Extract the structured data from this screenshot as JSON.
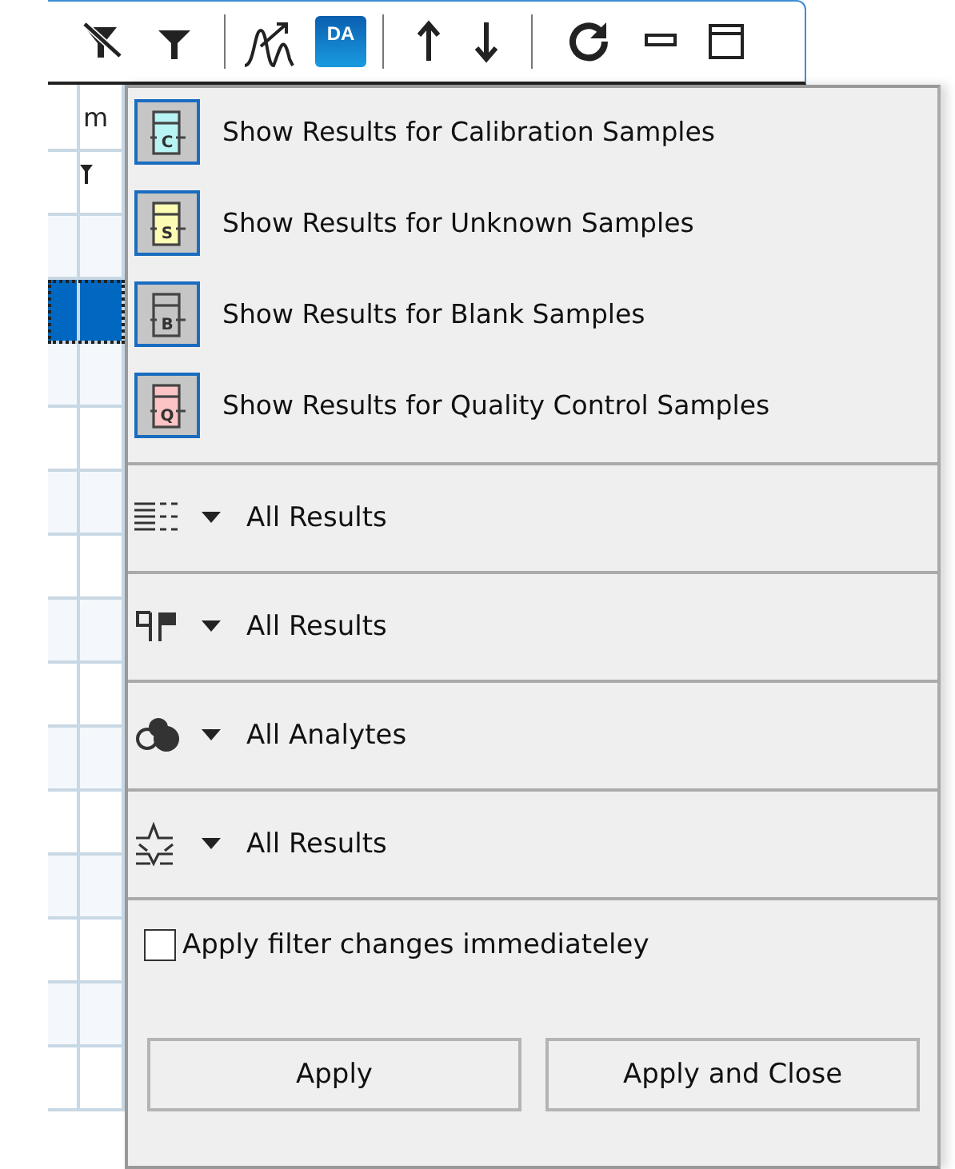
{
  "toolbar": {
    "badge": "DA"
  },
  "table": {
    "header": "m",
    "rows": [
      {
        "selected": false
      },
      {
        "selected": true
      },
      {
        "selected": false
      },
      {
        "selected": false
      },
      {
        "selected": false
      },
      {
        "selected": false
      },
      {
        "selected": false
      },
      {
        "selected": false
      },
      {
        "selected": false
      },
      {
        "selected": false
      },
      {
        "selected": false
      },
      {
        "selected": false
      },
      {
        "selected": false
      },
      {
        "selected": false
      }
    ]
  },
  "sample_filters": [
    {
      "label": "Show Results for Calibration Samples",
      "letter": "C",
      "color": "#b8f4f4",
      "selected": true
    },
    {
      "label": "Show Results for Unknown Samples",
      "letter": "S",
      "color": "#fcfcb4",
      "selected": true
    },
    {
      "label": "Show Results for Blank Samples",
      "letter": "B",
      "color": "#c4c4c4",
      "selected": true
    },
    {
      "label": "Show Results for Quality Control Samples",
      "letter": "Q",
      "color": "#fcc4c4",
      "selected": true
    }
  ],
  "dropdowns": [
    {
      "kind": "list",
      "value": "All Results"
    },
    {
      "kind": "flags",
      "value": "All Results"
    },
    {
      "kind": "analytes",
      "value": "All Analytes"
    },
    {
      "kind": "peaks",
      "value": "All Results"
    }
  ],
  "apply_immediately": {
    "label": "Apply filter changes immediateley",
    "checked": false
  },
  "buttons": [
    "Apply",
    "Apply and Close"
  ]
}
